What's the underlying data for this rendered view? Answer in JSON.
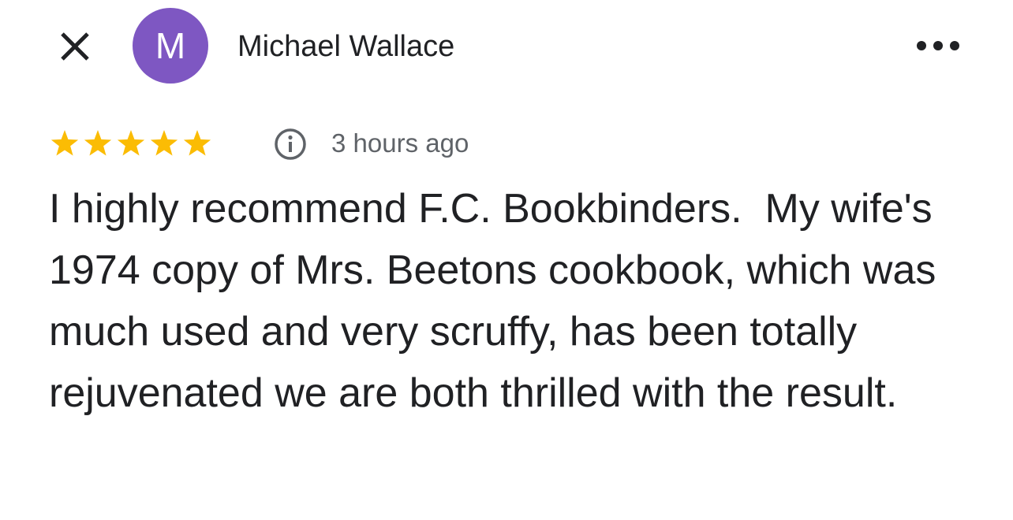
{
  "header": {
    "close_icon": "close-icon",
    "avatar_letter": "M",
    "avatar_color": "#7e57c2",
    "author_name": "Michael Wallace",
    "more_icon": "more-horizontal-icon"
  },
  "review": {
    "rating": 5,
    "rating_max": 5,
    "star_color": "#fbbc04",
    "info_icon": "info-icon",
    "timestamp": "3 hours ago",
    "text": "I highly recommend F.C. Bookbinders.  My wife's 1974 copy of Mrs. Beetons cookbook, which was  much used and very scruffy, has been totally rejuvenated we are both thrilled with the result."
  }
}
